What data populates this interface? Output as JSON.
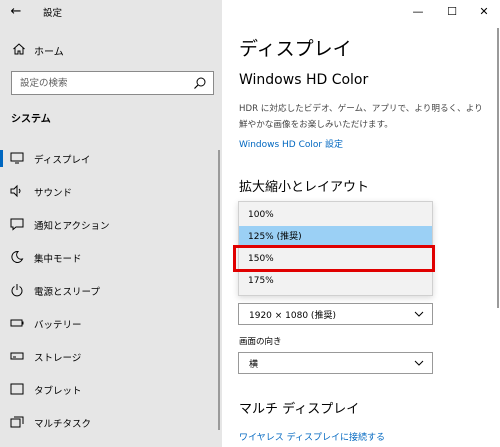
{
  "window": {
    "app_title": "設定",
    "back_icon": "arrow-left-icon",
    "controls": {
      "minimize": "—",
      "maximize": "☐",
      "close": "✕"
    }
  },
  "sidebar": {
    "home_label": "ホーム",
    "search_placeholder": "設定の検索",
    "section_title": "システム",
    "items": [
      {
        "label": "ディスプレイ",
        "icon": "monitor-icon",
        "selected": true
      },
      {
        "label": "サウンド",
        "icon": "speaker-icon",
        "selected": false
      },
      {
        "label": "通知とアクション",
        "icon": "message-icon",
        "selected": false
      },
      {
        "label": "集中モード",
        "icon": "moon-icon",
        "selected": false
      },
      {
        "label": "電源とスリープ",
        "icon": "power-icon",
        "selected": false
      },
      {
        "label": "バッテリー",
        "icon": "battery-icon",
        "selected": false
      },
      {
        "label": "ストレージ",
        "icon": "storage-icon",
        "selected": false
      },
      {
        "label": "タブレット",
        "icon": "tablet-icon",
        "selected": false
      },
      {
        "label": "マルチタスク",
        "icon": "multitask-icon",
        "selected": false
      }
    ]
  },
  "main": {
    "page_title": "ディスプレイ",
    "hd_color": {
      "title": "Windows HD Color",
      "description": "HDR に対応したビデオ、ゲーム、アプリで、より明るく、より鮮やかな画像をお楽しみいただけます。",
      "link": "Windows HD Color 設定"
    },
    "scale_layout": {
      "title": "拡大縮小とレイアウト",
      "options": [
        "100%",
        "125% (推奨)",
        "150%",
        "175%"
      ],
      "highlighted_index": 1,
      "boxed_index": 2
    },
    "resolution": {
      "value": "1920 × 1080 (推奨)"
    },
    "orientation": {
      "label": "画面の向き",
      "value": "横"
    },
    "multi_display": {
      "title": "マルチ ディスプレイ",
      "link": "ワイヤレス ディスプレイに接続する"
    }
  },
  "colors": {
    "accent": "#0067c0",
    "highlight": "#9bd0f5",
    "callout": "#e00000",
    "sidebar_bg": "#e6e6e6"
  }
}
